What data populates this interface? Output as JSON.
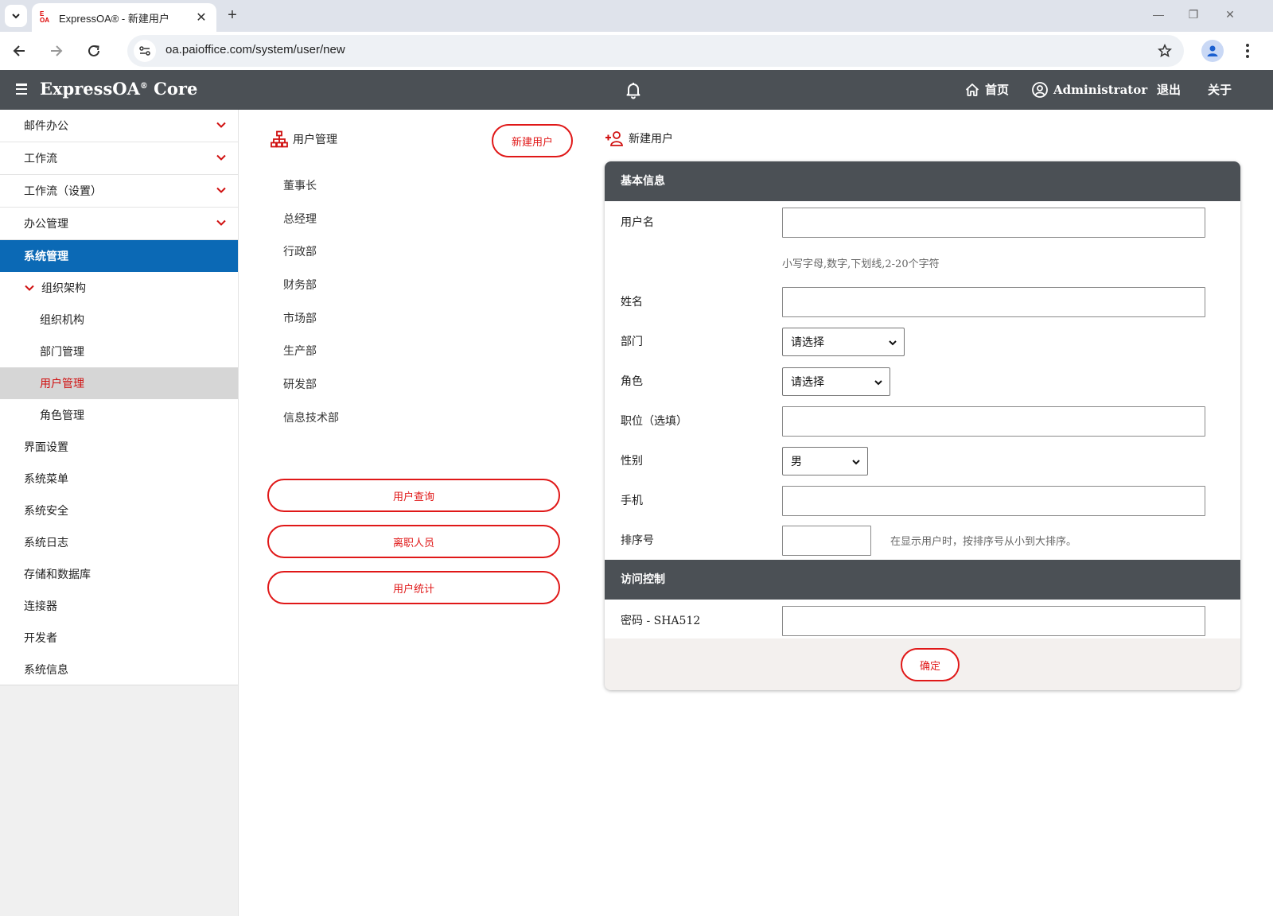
{
  "browser": {
    "tab_title": "ExpressOA® - 新建用户",
    "favicon_text_top": "E",
    "favicon_text_bottom": "OA",
    "url": "oa.paioffice.com/system/user/new"
  },
  "appbar": {
    "brand": "ExpressOA",
    "brand_mark": "®",
    "brand_suffix": " Core",
    "home_label": "首页",
    "user_label": "Administrator",
    "logout_label": "退出",
    "about_label": "关于"
  },
  "sidebar": {
    "items": [
      {
        "label": "邮件办公"
      },
      {
        "label": "工作流"
      },
      {
        "label": "工作流（设置）"
      },
      {
        "label": "办公管理"
      },
      {
        "label": "系统管理"
      },
      {
        "label": "组织架构"
      },
      {
        "label": "组织机构"
      },
      {
        "label": "部门管理"
      },
      {
        "label": "用户管理"
      },
      {
        "label": "角色管理"
      },
      {
        "label": "界面设置"
      },
      {
        "label": "系统菜单"
      },
      {
        "label": "系统安全"
      },
      {
        "label": "系统日志"
      },
      {
        "label": "存储和数据库"
      },
      {
        "label": "连接器"
      },
      {
        "label": "开发者"
      },
      {
        "label": "系统信息"
      }
    ]
  },
  "middle": {
    "title": "用户管理",
    "new_user_button": "新建用户",
    "departments": [
      "董事长",
      "总经理",
      "行政部",
      "财务部",
      "市场部",
      "生产部",
      "研发部",
      "信息技术部"
    ],
    "buttons": [
      "用户查询",
      "离职人员",
      "用户统计"
    ]
  },
  "form": {
    "heading": "新建用户",
    "section_basic": "基本信息",
    "username_label": "用户名",
    "username_value": "",
    "username_hint": "小写字母,数字,下划线,2-20个字符",
    "name_label": "姓名",
    "name_value": "",
    "dept_label": "部门",
    "dept_selected": "请选择",
    "role_label": "角色",
    "role_selected": "请选择",
    "position_label": "职位（选填）",
    "position_value": "",
    "gender_label": "性别",
    "gender_selected": "男",
    "mobile_label": "手机",
    "mobile_value": "",
    "order_label": "排序号",
    "order_value": "",
    "order_hint": "在显示用户时，按排序号从小到大排序。",
    "section_access": "访问控制",
    "password_label": "密码 - SHA512",
    "password_value": "",
    "confirm_button": "确定"
  },
  "colors": {
    "accent_red": "#e01818",
    "header_gray": "#4b5055",
    "active_blue": "#0b69b5"
  }
}
